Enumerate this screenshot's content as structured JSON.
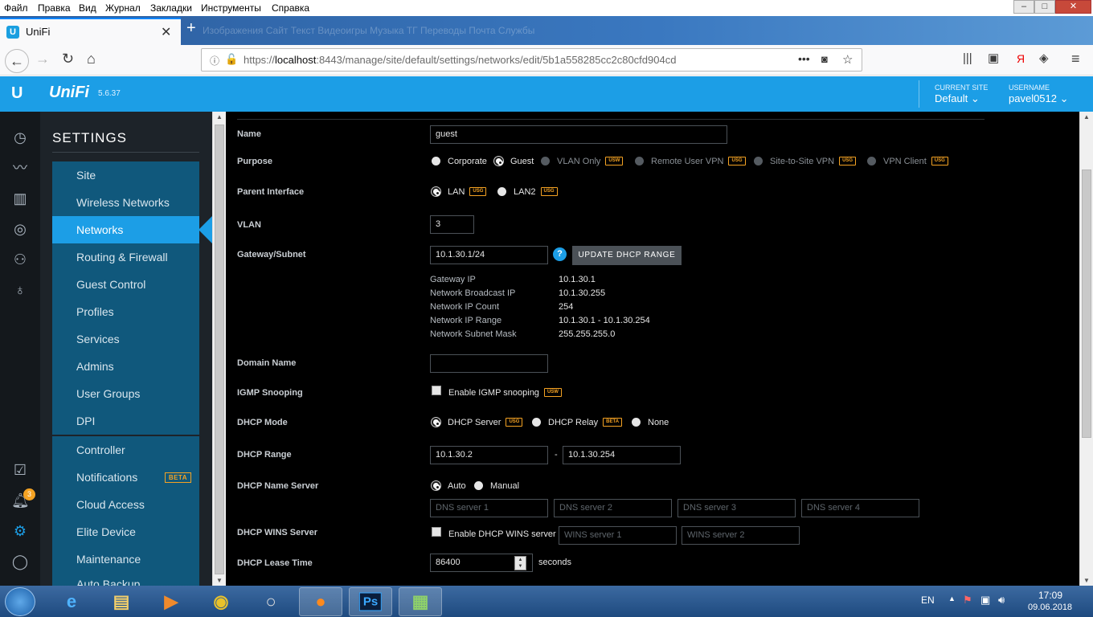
{
  "menu": [
    "Файл",
    "Правка",
    "Вид",
    "Журнал",
    "Закладки",
    "Инструменты",
    "Справка"
  ],
  "window_buttons": {
    "minimize": "–",
    "maximize": "□",
    "close": "✕"
  },
  "tab": {
    "title": "UniFi",
    "icon": "U",
    "close": "✕",
    "new_tab": "+"
  },
  "ghost_tabs": "Изображения   Сайт   Текст   Видеоигры   Музыка   ТГ   Переводы   Почта   Службы",
  "url": {
    "prefix": "https://",
    "host": "localhost",
    "rest": ":8443/manage/site/default/settings/networks/edit/5b1a558285cc2c80cfd904cd"
  },
  "header": {
    "logo": "U",
    "brand": "UniFi",
    "version": "5.6.37",
    "current_site_label": "CURRENT SITE",
    "current_site": "Default",
    "username_label": "USERNAME",
    "username": "pavel0512",
    "notification_count": "3"
  },
  "sidebar": {
    "title": "SETTINGS",
    "items": [
      "Site",
      "Wireless Networks",
      "Networks",
      "Routing & Firewall",
      "Guest Control",
      "Profiles",
      "Services",
      "Admins",
      "User Groups",
      "DPI"
    ],
    "items2": [
      "Controller",
      "Notifications",
      "Cloud Access",
      "Elite Device",
      "Maintenance"
    ],
    "notifications_badge": "BETA",
    "cut_item": "Auto Backup"
  },
  "form": {
    "name_label": "Name",
    "name_value": "guest",
    "purpose_label": "Purpose",
    "purpose_options": [
      "Corporate",
      "Guest",
      "VLAN Only",
      "Remote User VPN",
      "Site-to-Site VPN",
      "VPN Client"
    ],
    "tag_usw": "USW",
    "tag_usg": "USG",
    "tag_beta": "BETA",
    "parent_label": "Parent Interface",
    "parent_options": [
      "LAN",
      "LAN2"
    ],
    "vlan_label": "VLAN",
    "vlan_value": "3",
    "gateway_label": "Gateway/Subnet",
    "gateway_value": "10.1.30.1/24",
    "help": "?",
    "update_button": "UPDATE DHCP RANGE",
    "info": [
      {
        "k": "Gateway IP",
        "v": "10.1.30.1"
      },
      {
        "k": "Network Broadcast IP",
        "v": "10.1.30.255"
      },
      {
        "k": "Network IP Count",
        "v": "254"
      },
      {
        "k": "Network IP Range",
        "v": "10.1.30.1 - 10.1.30.254"
      },
      {
        "k": "Network Subnet Mask",
        "v": "255.255.255.0"
      }
    ],
    "domain_label": "Domain Name",
    "domain_value": "",
    "igmp_label": "IGMP Snooping",
    "igmp_option": "Enable IGMP snooping",
    "dhcp_mode_label": "DHCP Mode",
    "dhcp_mode_options": [
      "DHCP Server",
      "DHCP Relay",
      "None"
    ],
    "dhcp_range_label": "DHCP Range",
    "dhcp_range_start": "10.1.30.2",
    "dhcp_range_sep": "-",
    "dhcp_range_end": "10.1.30.254",
    "dns_label": "DHCP Name Server",
    "dns_options": [
      "Auto",
      "Manual"
    ],
    "dns_placeholders": [
      "DNS server 1",
      "DNS server 2",
      "DNS server 3",
      "DNS server 4"
    ],
    "wins_label": "DHCP WINS Server",
    "wins_option": "Enable DHCP WINS server",
    "wins_placeholders": [
      "WINS server 1",
      "WINS server 2"
    ],
    "lease_label": "DHCP Lease Time",
    "lease_value": "86400",
    "lease_unit": "seconds"
  },
  "taskbar": {
    "lang": "EN",
    "time": "17:09",
    "date": "09.06.2018"
  }
}
